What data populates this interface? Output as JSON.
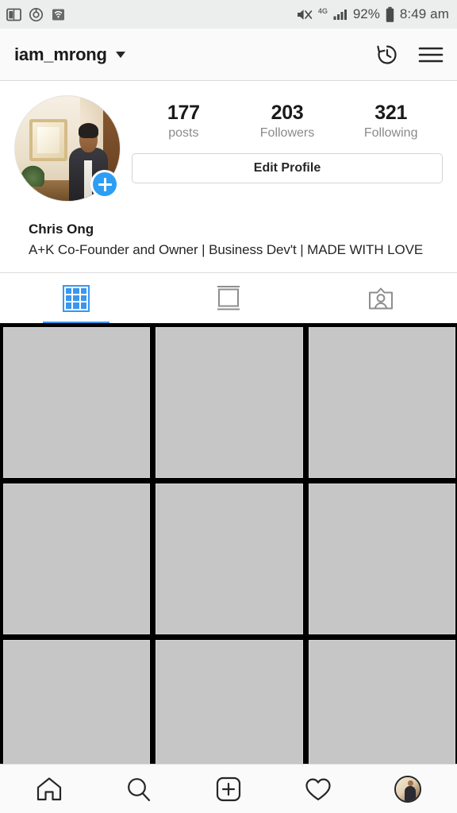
{
  "status_bar": {
    "time": "8:49 am",
    "battery_pct": "92%",
    "network": "4G",
    "left_icons": [
      "book-reader-icon",
      "record-circle-icon",
      "wifi-box-icon"
    ],
    "right_icons": [
      "mute-icon",
      "signal-bars-icon",
      "battery-icon"
    ]
  },
  "header": {
    "username": "iam_mrong",
    "dropdown_icon": "chevron-down-icon",
    "history_icon": "archive-history-icon",
    "menu_icon": "hamburger-menu-icon"
  },
  "profile": {
    "avatar_alt": "profile-photo",
    "add_story_badge": "plus-badge",
    "stats": [
      {
        "number": "177",
        "label": "posts"
      },
      {
        "number": "203",
        "label": "Followers"
      },
      {
        "number": "321",
        "label": "Following"
      }
    ],
    "edit_button": "Edit Profile",
    "display_name": "Chris Ong",
    "bio": "A+K Co-Founder and Owner | Business Dev't | MADE WITH LOVE"
  },
  "tabs": [
    {
      "name": "grid",
      "icon": "grid-icon",
      "active": true
    },
    {
      "name": "list",
      "icon": "list-view-icon",
      "active": false
    },
    {
      "name": "tagged",
      "icon": "tagged-person-icon",
      "active": false
    }
  ],
  "photo_grid": {
    "columns": 3,
    "cells": [
      "post-1",
      "post-2",
      "post-3",
      "post-4",
      "post-5",
      "post-6",
      "post-7",
      "post-8",
      "post-9"
    ]
  },
  "bottom_nav": [
    {
      "name": "home",
      "icon": "home-icon",
      "active": false
    },
    {
      "name": "search",
      "icon": "search-icon",
      "active": false
    },
    {
      "name": "add",
      "icon": "plus-square-icon",
      "active": false
    },
    {
      "name": "activity",
      "icon": "heart-icon",
      "active": false
    },
    {
      "name": "profile",
      "icon": "profile-avatar-icon",
      "active": true
    }
  ],
  "colors": {
    "accent_blue": "#3897f0",
    "badge_blue": "#2e9ef4",
    "status_bar_bg": "#eceded",
    "header_bg": "#fafafa",
    "placeholder_gray": "#c6c6c6",
    "text_primary": "#262626",
    "text_muted": "#8a8a8a"
  }
}
